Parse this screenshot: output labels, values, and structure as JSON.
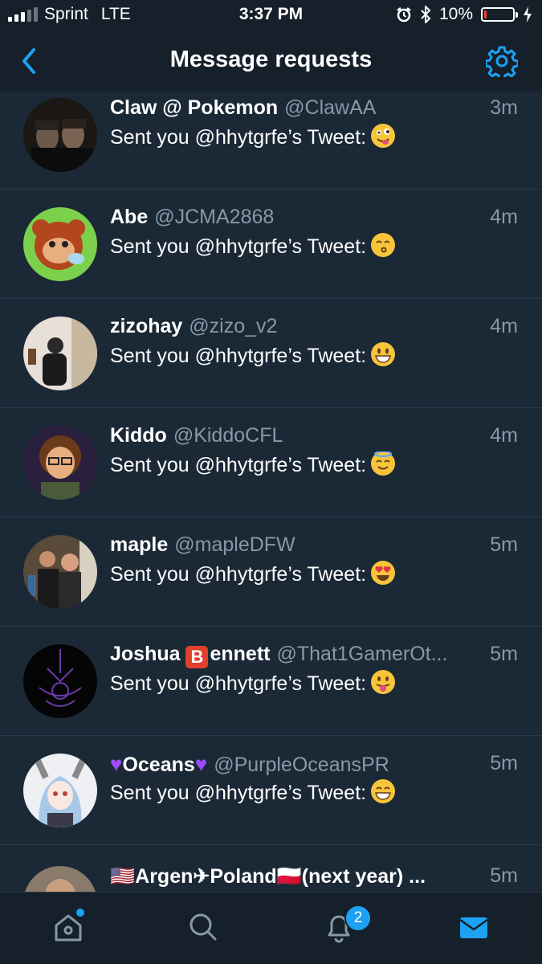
{
  "status_bar": {
    "carrier": "Sprint",
    "network": "LTE",
    "time": "3:37 PM",
    "battery": "10%",
    "battery_level": 0.1
  },
  "header": {
    "title": "Message requests"
  },
  "requests": [
    {
      "name": "Claw @ Pokemon",
      "handle": "@ClawAA",
      "time": "3m",
      "preview": "Sent you @hhytgrfe’s Tweet:",
      "emoji": "zany-face"
    },
    {
      "name": "Abe",
      "handle": "@JCMA2868",
      "time": "4m",
      "preview": "Sent you @hhytgrfe’s Tweet:",
      "emoji": "kissing-face"
    },
    {
      "name": "zizohay",
      "handle": "@zizo_v2",
      "time": "4m",
      "preview": "Sent you @hhytgrfe’s Tweet:",
      "emoji": "grinning-face"
    },
    {
      "name": "Kiddo",
      "handle": "@KiddoCFL",
      "time": "4m",
      "preview": "Sent you @hhytgrfe’s Tweet:",
      "emoji": "halo-face"
    },
    {
      "name": "maple",
      "handle": "@mapleDFW",
      "time": "5m",
      "preview": "Sent you @hhytgrfe’s Tweet:",
      "emoji": "heart-eyes-face"
    },
    {
      "name_before": "Joshua ",
      "name_badge": "B",
      "name_after": "ennett",
      "handle": "@That1GamerOt...",
      "time": "5m",
      "preview": "Sent you @hhytgrfe’s Tweet:",
      "emoji": "tongue-face"
    },
    {
      "name": "Oceans",
      "handle": "@PurpleOceansPR",
      "time": "5m",
      "preview": "Sent you @hhytgrfe’s Tweet:",
      "emoji": "grinning-smile-face"
    },
    {
      "name_prefix": "🇺🇸",
      "name_mid": "Argen✈Poland",
      "name_flag": "🇵🇱",
      "name_suffix": "(next year) ...",
      "time": "5m"
    }
  ],
  "tab_bar": {
    "items": [
      "home-icon",
      "search-icon",
      "bell-icon",
      "mail-icon"
    ],
    "notifications_count": "2",
    "active": "mail-icon"
  },
  "colors": {
    "background": "#1b2836",
    "bar": "#15202b",
    "accent": "#1da1f2",
    "secondary_text": "#8899a6"
  }
}
